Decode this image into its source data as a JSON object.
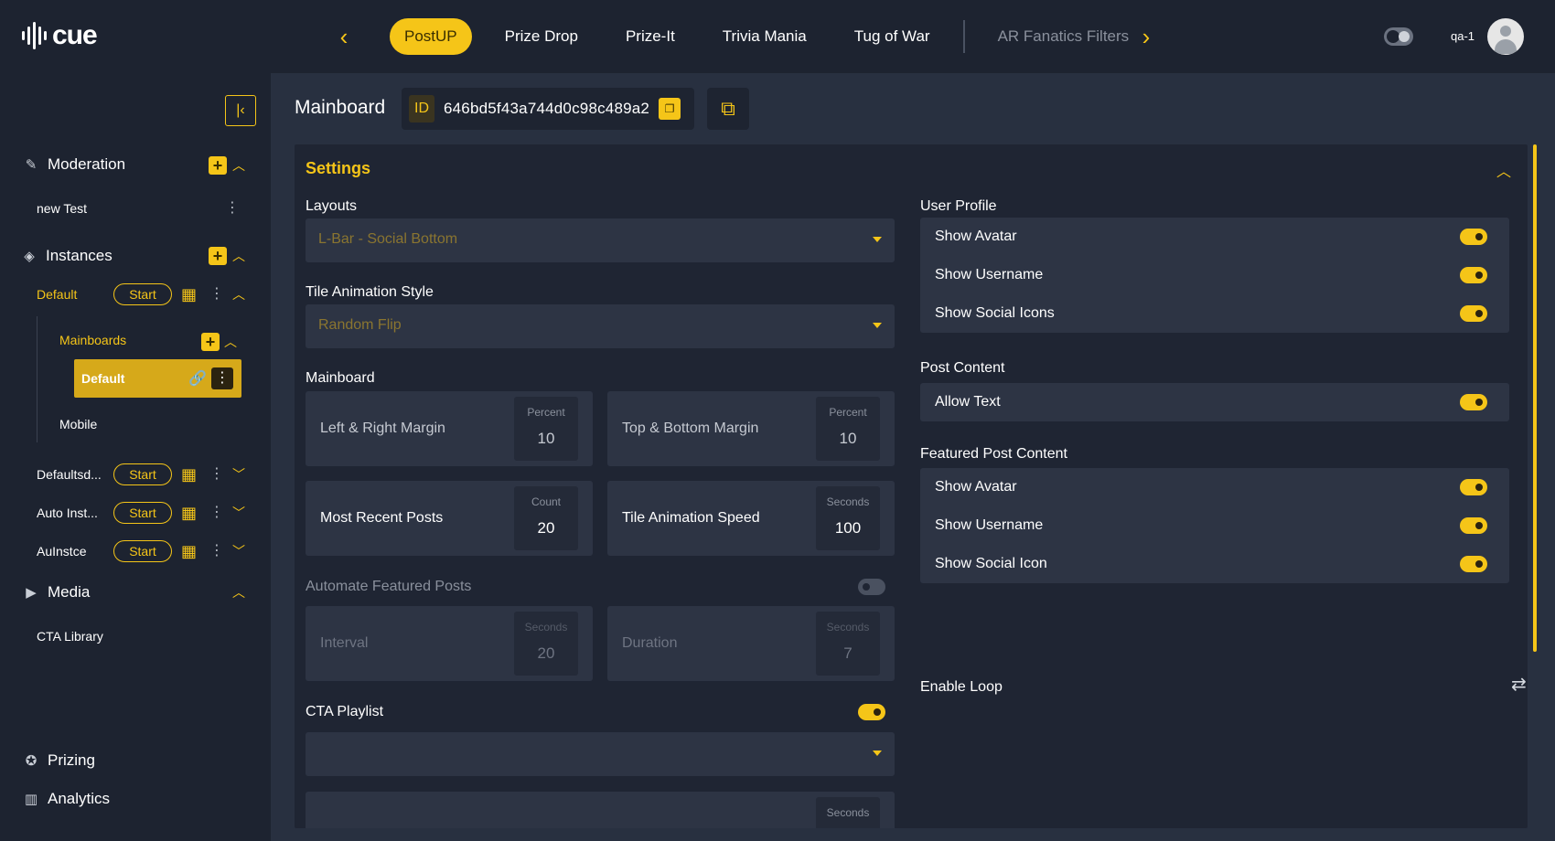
{
  "app": {
    "logo_text": "cue",
    "username": "qa-1",
    "accent": "#f5c518"
  },
  "tabs": [
    {
      "label": "PostUP",
      "active": true
    },
    {
      "label": "Prize Drop"
    },
    {
      "label": "Prize-It"
    },
    {
      "label": "Trivia Mania"
    },
    {
      "label": "Tug of War"
    },
    {
      "label": "AR Fanatics Filters",
      "dim": true
    }
  ],
  "sidebar": {
    "moderation": {
      "label": "Moderation",
      "items": [
        "new Test"
      ]
    },
    "instances": {
      "label": "Instances",
      "default": {
        "label": "Default",
        "start": "Start"
      },
      "mainboards": {
        "label": "Mainboards",
        "items": [
          "Default",
          "Mobile"
        ]
      },
      "others": [
        {
          "label": "Defaultsd...",
          "start": "Start"
        },
        {
          "label": "Auto Inst...",
          "start": "Start"
        },
        {
          "label": "AuInstce",
          "start": "Start"
        }
      ]
    },
    "media": {
      "label": "Media",
      "items": [
        "CTA Library"
      ]
    },
    "prizing": "Prizing",
    "analytics": "Analytics"
  },
  "header": {
    "title": "Mainboard",
    "id_tag": "ID",
    "id_value": "646bd5f43a744d0c98c489a2"
  },
  "settings": {
    "title": "Settings",
    "layouts": {
      "label": "Layouts",
      "value": "L-Bar - Social Bottom"
    },
    "tile_animation_style": {
      "label": "Tile Animation Style",
      "value": "Random Flip"
    },
    "mainboard": {
      "label": "Mainboard",
      "left_right": {
        "label": "Left & Right Margin",
        "unit": "Percent",
        "value": "10"
      },
      "top_bottom": {
        "label": "Top & Bottom Margin",
        "unit": "Percent",
        "value": "10"
      },
      "recent_posts": {
        "label": "Most Recent Posts",
        "unit": "Count",
        "value": "20"
      },
      "anim_speed": {
        "label": "Tile Animation Speed",
        "unit": "Seconds",
        "value": "100"
      }
    },
    "automate": {
      "label": "Automate Featured Posts",
      "enabled": false,
      "interval": {
        "label": "Interval",
        "unit": "Seconds",
        "value": "20"
      },
      "duration": {
        "label": "Duration",
        "unit": "Seconds",
        "value": "7"
      }
    },
    "cta_playlist": {
      "label": "CTA Playlist",
      "enabled": true,
      "value": "",
      "next_unit": "Seconds"
    },
    "user_profile": {
      "label": "User Profile",
      "items": [
        "Show Avatar",
        "Show Username",
        "Show Social Icons"
      ]
    },
    "post_content": {
      "label": "Post Content",
      "items": [
        "Allow Text"
      ]
    },
    "featured_post_content": {
      "label": "Featured Post Content",
      "items": [
        "Show Avatar",
        "Show Username",
        "Show Social Icon"
      ]
    },
    "enable_loop": "Enable Loop"
  }
}
